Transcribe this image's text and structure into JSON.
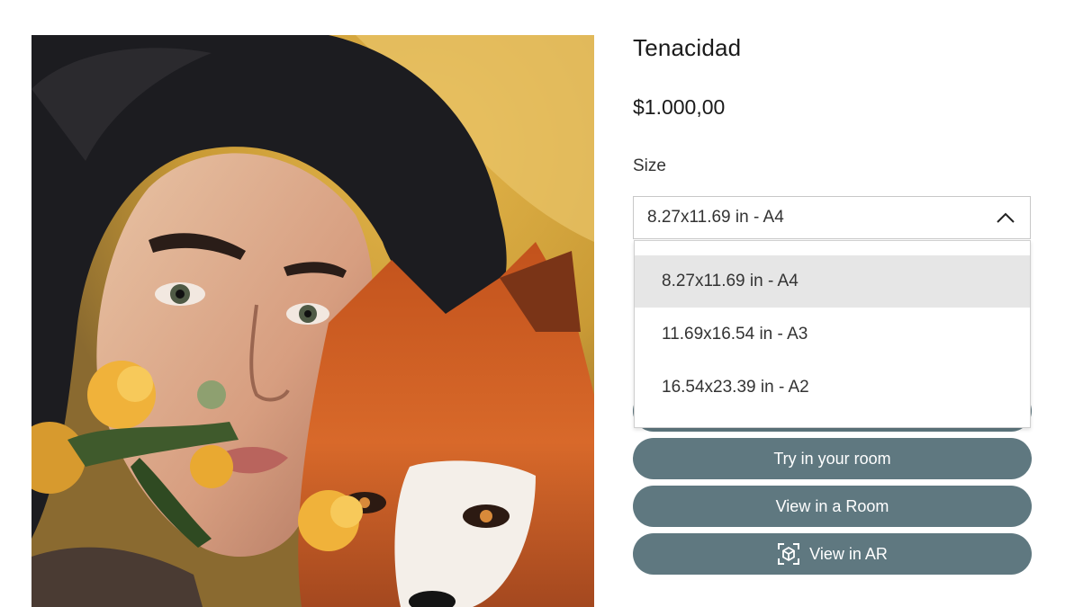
{
  "product": {
    "title": "Tenacidad",
    "price": "$1.000,00"
  },
  "size": {
    "label": "Size",
    "selected": "8.27x11.69 in - A4",
    "options": [
      {
        "label": "8.27x11.69 in - A4",
        "selected": true
      },
      {
        "label": "11.69x16.54 in - A3",
        "selected": false
      },
      {
        "label": "16.54x23.39 in - A2",
        "selected": false
      }
    ]
  },
  "buttons": {
    "try_in_room": "Try in your room",
    "view_in_room": "View in a Room",
    "view_in_ar": "View in AR"
  },
  "colors": {
    "button_bg": "#5f7880",
    "option_selected_bg": "#e6e6e6"
  },
  "icons": {
    "chevron": "chevron-up-icon",
    "ar": "ar-cube-icon"
  }
}
